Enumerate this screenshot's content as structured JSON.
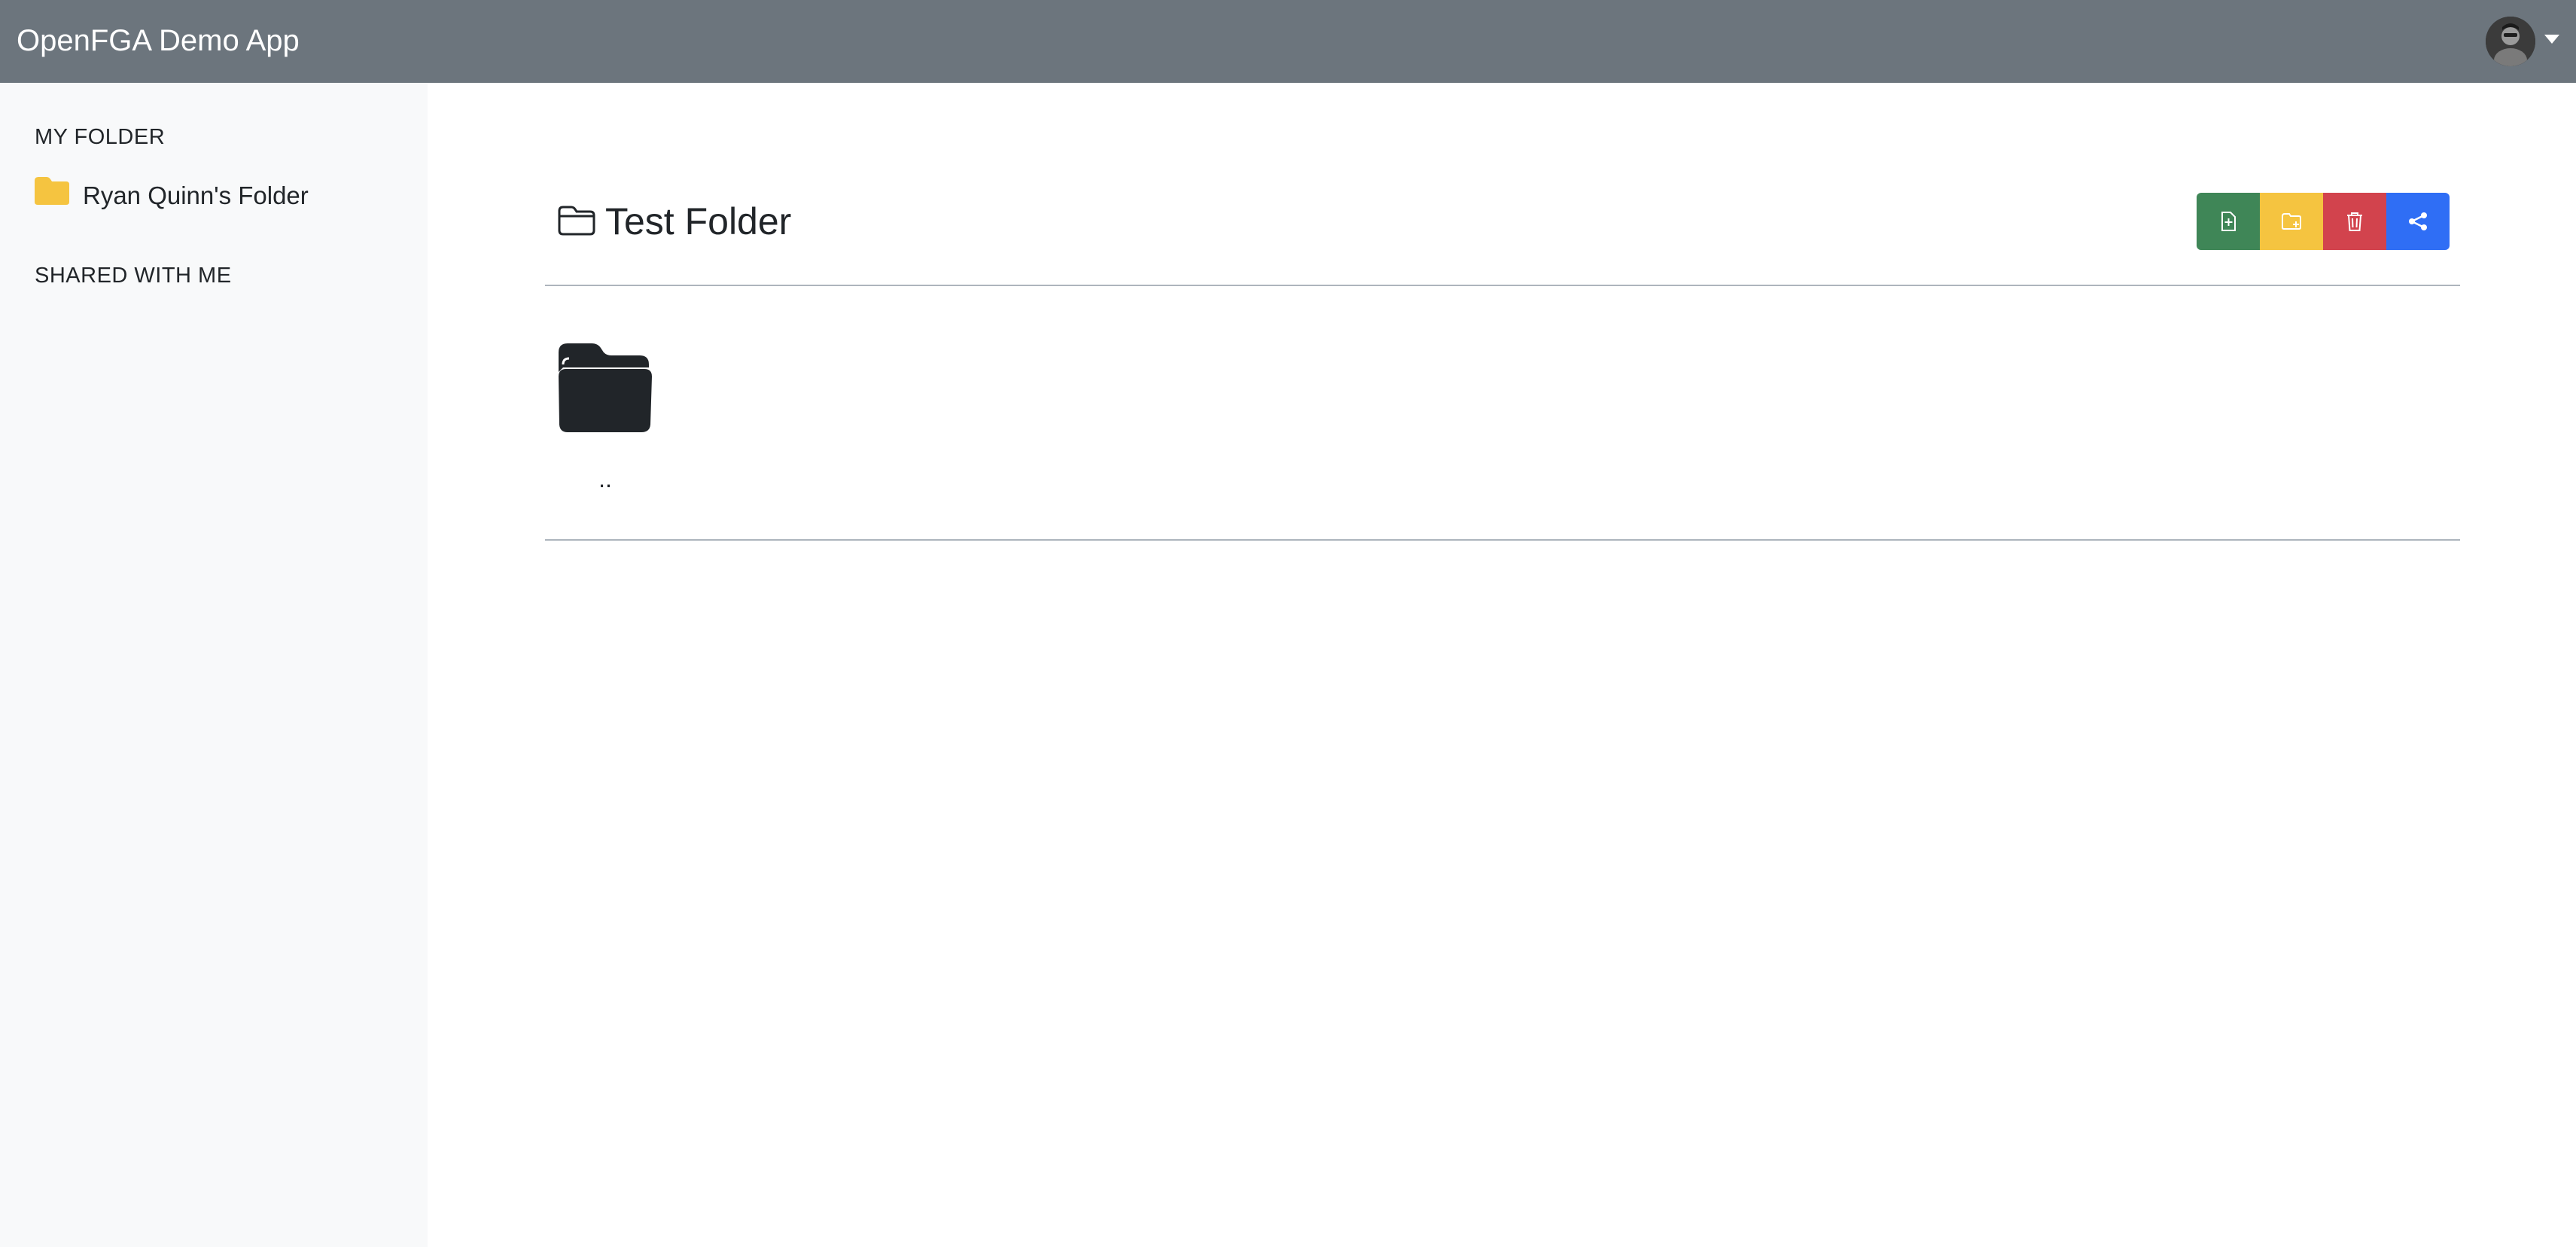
{
  "app": {
    "brand": "OpenFGA Demo App"
  },
  "user_menu": {
    "avatar_icon": "user-avatar-icon",
    "caret_icon": "caret-down-icon"
  },
  "sidebar": {
    "my_folder_heading": "MY FOLDER",
    "items": [
      {
        "label": "Ryan Quinn's Folder",
        "icon": "folder-fill-icon"
      }
    ],
    "shared_heading": "SHARED WITH ME"
  },
  "main": {
    "title": "Test Folder",
    "title_icon": "folder-outline-icon",
    "toolbar": [
      {
        "name": "new-file-button",
        "icon": "file-plus-icon",
        "color": "#3f8657"
      },
      {
        "name": "new-folder-button",
        "icon": "folder-plus-icon",
        "color": "#f5c440"
      },
      {
        "name": "delete-button",
        "icon": "trash-icon",
        "color": "#d2434d"
      },
      {
        "name": "share-button",
        "icon": "share-icon",
        "color": "#2f6ef5"
      }
    ],
    "entries": [
      {
        "label": "..",
        "icon": "folder-fill-icon"
      }
    ]
  },
  "colors": {
    "navbar": "#6c757d",
    "sidebar_bg": "#f8f9fa",
    "folder_yellow": "#f5c440",
    "text": "#212529"
  }
}
